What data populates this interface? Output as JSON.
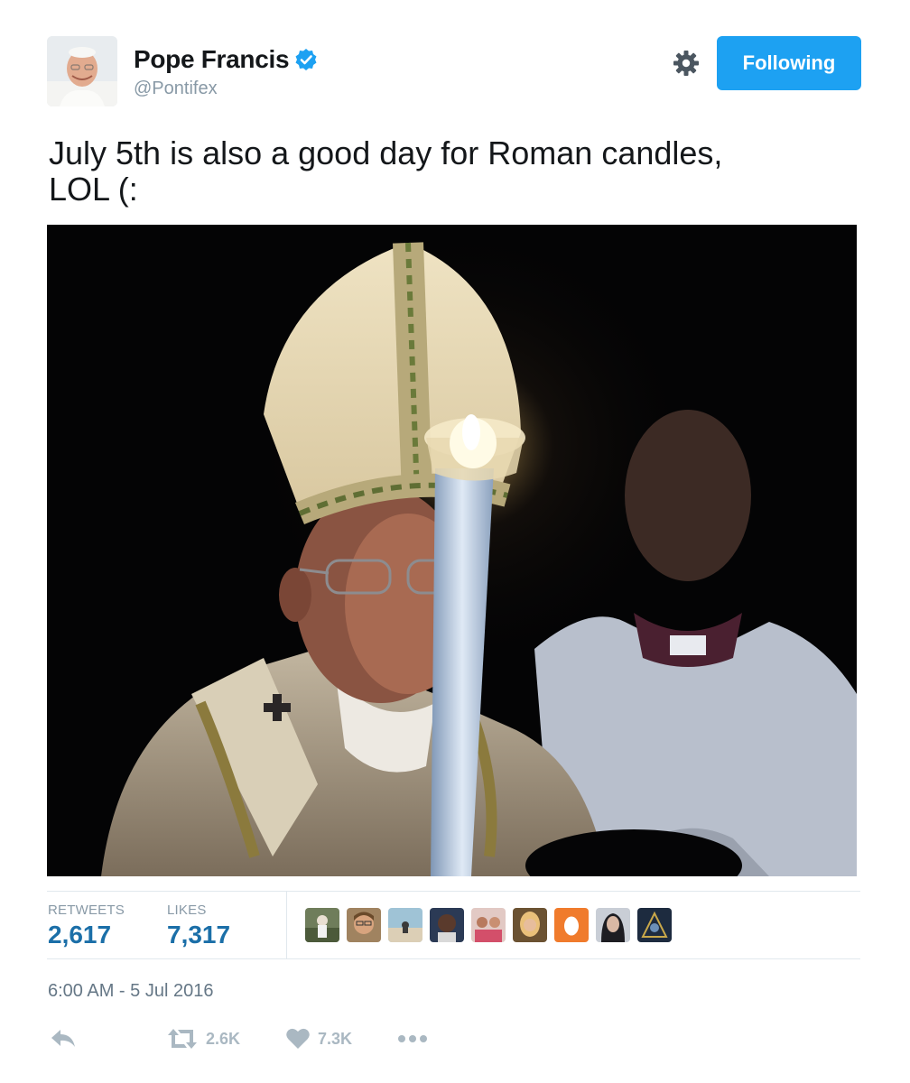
{
  "user": {
    "display_name": "Pope Francis",
    "handle": "@Pontifex",
    "verified": true
  },
  "header": {
    "follow_label": "Following",
    "settings_icon": "gear-icon"
  },
  "tweet": {
    "text": "July 5th is also a good day for Roman candles,\nLOL  (:"
  },
  "stats": {
    "retweets_label": "RETWEETS",
    "retweets_value": "2,617",
    "likes_label": "LIKES",
    "likes_value": "7,317"
  },
  "timestamp": "6:00 AM - 5 Jul 2016",
  "actions": {
    "reply_icon": "reply-icon",
    "retweet_icon": "retweet-icon",
    "retweet_count": "2.6K",
    "like_icon": "heart-icon",
    "like_count": "7.3K",
    "more_icon": "more-icon"
  },
  "colors": {
    "accent": "#1da1f2",
    "stat_value": "#1b6fa8",
    "muted": "#8899a6",
    "icon": "#aab8c2"
  }
}
